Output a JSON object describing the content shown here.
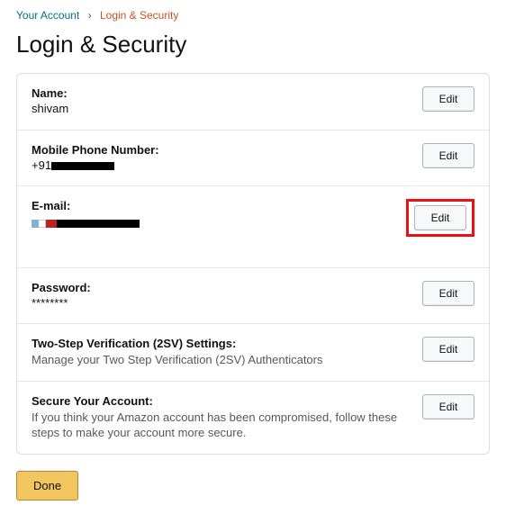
{
  "breadcrumb": {
    "account_label": "Your Account",
    "separator": "›",
    "current_label": "Login & Security"
  },
  "page_title": "Login & Security",
  "rows": {
    "name": {
      "label": "Name:",
      "value": "shivam",
      "edit_label": "Edit"
    },
    "phone": {
      "label": "Mobile Phone Number:",
      "prefix": "+91",
      "edit_label": "Edit"
    },
    "email": {
      "label": "E-mail:",
      "edit_label": "Edit"
    },
    "password": {
      "label": "Password:",
      "value": "********",
      "edit_label": "Edit"
    },
    "tsv": {
      "label": "Two-Step Verification (2SV) Settings:",
      "desc": "Manage your Two Step Verification (2SV) Authenticators",
      "edit_label": "Edit"
    },
    "secure": {
      "label": "Secure Your Account:",
      "desc": "If you think your Amazon account has been compromised, follow these steps to make your account more secure.",
      "edit_label": "Edit"
    }
  },
  "done_label": "Done"
}
